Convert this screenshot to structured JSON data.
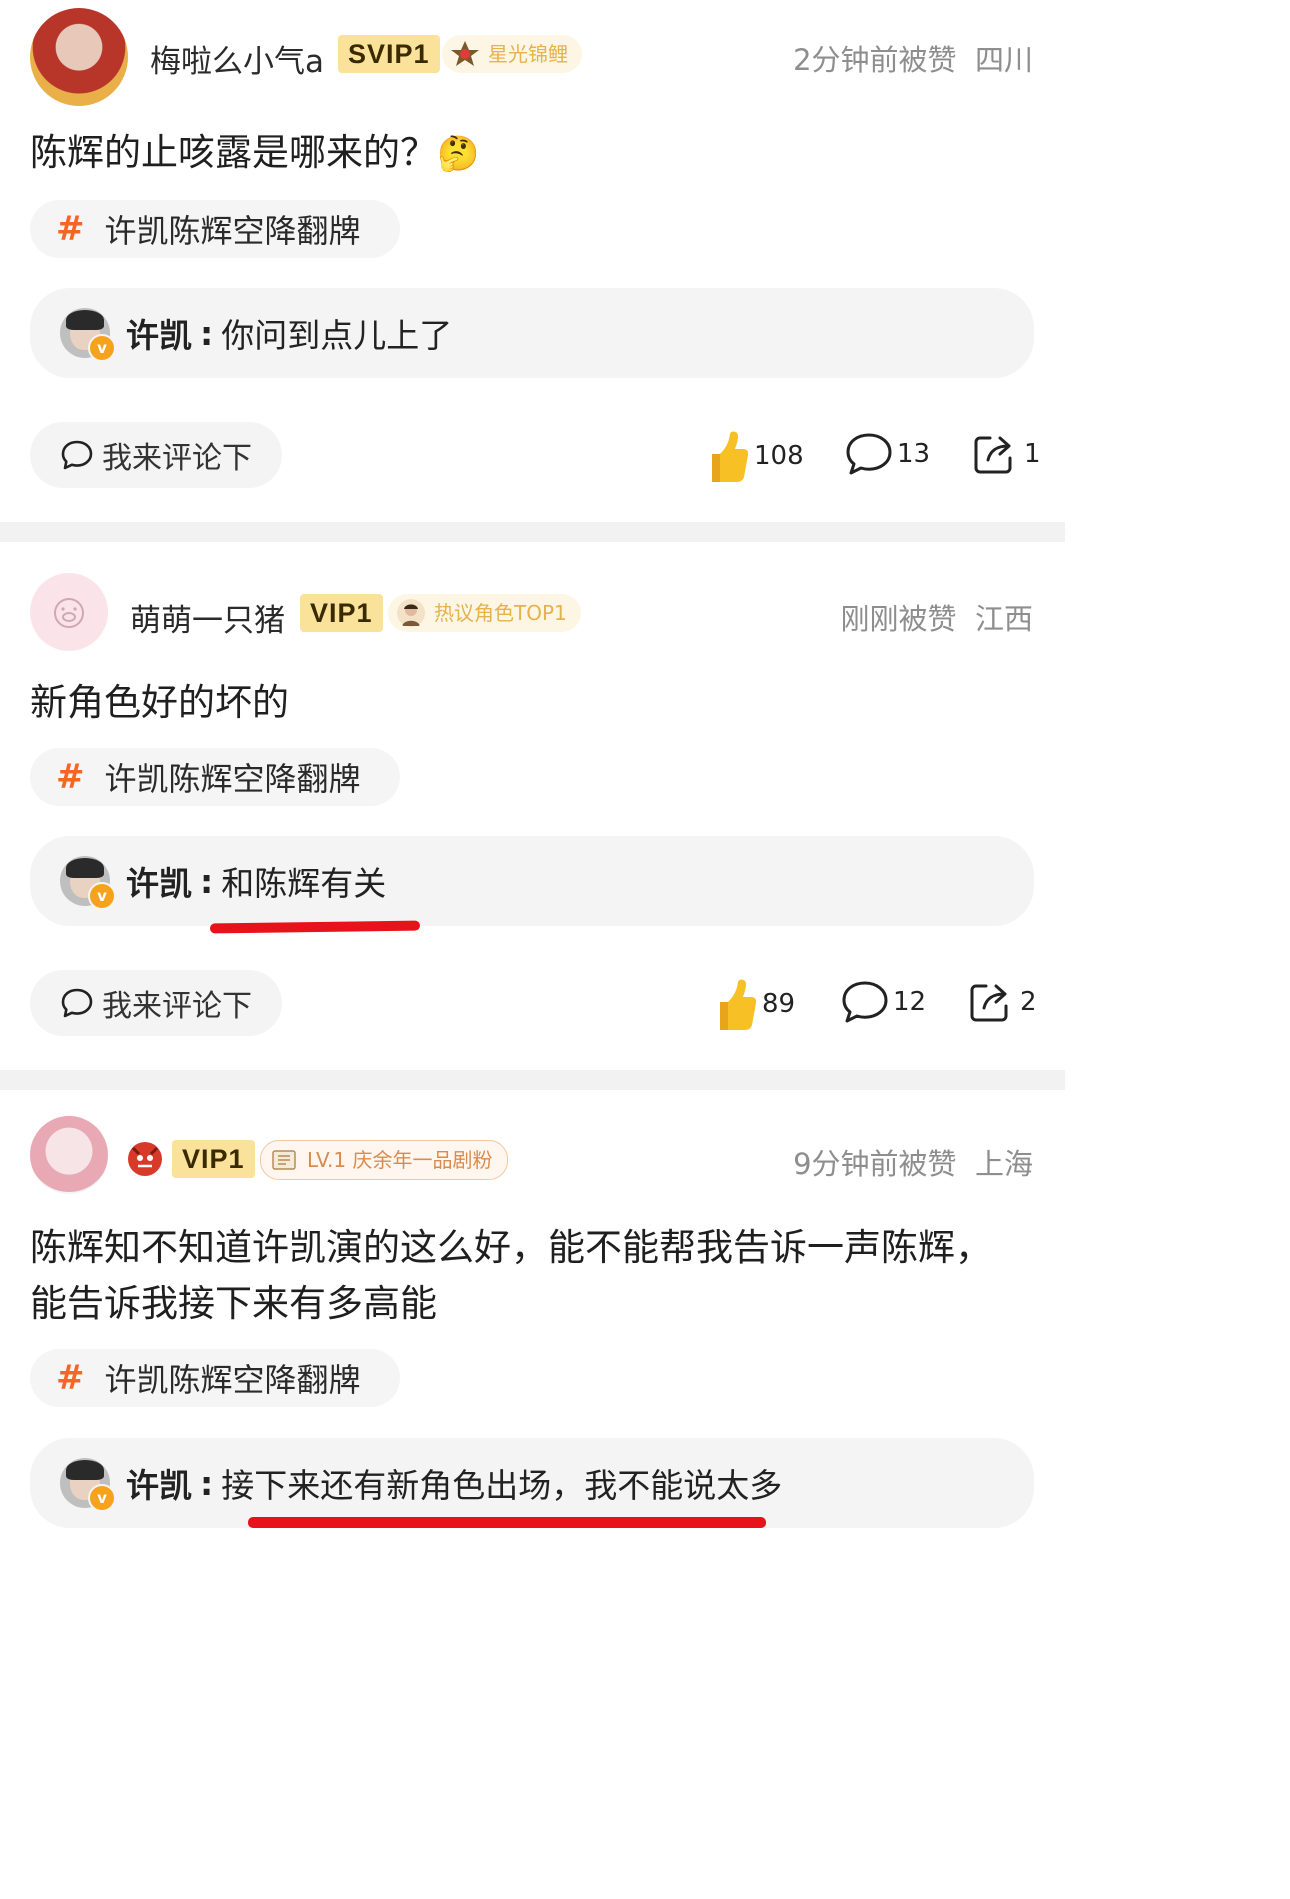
{
  "posts": [
    {
      "username": "梅啦么小气a",
      "vip": "SVIP1",
      "badge": "星光锦鲤",
      "time": "2分钟前被赞",
      "location": "四川",
      "content": "陈辉的止咳露是哪来的？",
      "content_emoji": "🤔",
      "topic": "许凯陈辉空降翻牌",
      "reply": {
        "name": "许凯",
        "colon": ":",
        "text": "你问到点儿上了"
      },
      "comment_button": "我来评论下",
      "likes": "108",
      "comments": "13",
      "shares": "1"
    },
    {
      "username": "萌萌一只猪",
      "vip": "VIP1",
      "badge": "热议角色TOP1",
      "time": "刚刚被赞",
      "location": "江西",
      "content": "新角色好的坏的",
      "topic": "许凯陈辉空降翻牌",
      "reply": {
        "name": "许凯",
        "colon": ":",
        "text": "和陈辉有关"
      },
      "comment_button": "我来评论下",
      "likes": "89",
      "comments": "12",
      "shares": "2"
    },
    {
      "vip": "VIP1",
      "badge": "LV.1 庆余年一品剧粉",
      "time": "9分钟前被赞",
      "location": "上海",
      "content": "陈辉知不知道许凯演的这么好，能不能帮我告诉一声陈辉，能告诉我接下来有多高能",
      "topic": "许凯陈辉空降翻牌",
      "reply": {
        "name": "许凯",
        "colon": ":",
        "text": "接下来还有新角色出场，我不能说太多"
      }
    }
  ],
  "icons": {
    "topic": "hash-icon",
    "comment_button": "chat-bubble-icon",
    "like": "thumbs-up-icon",
    "comment": "comment-icon",
    "share": "share-icon"
  },
  "colors": {
    "accent": "#f46623",
    "vip_bg": "#fbe29a",
    "badge_text": "#e5b24e",
    "underline": "#e8121a",
    "like": "#f7c025"
  }
}
